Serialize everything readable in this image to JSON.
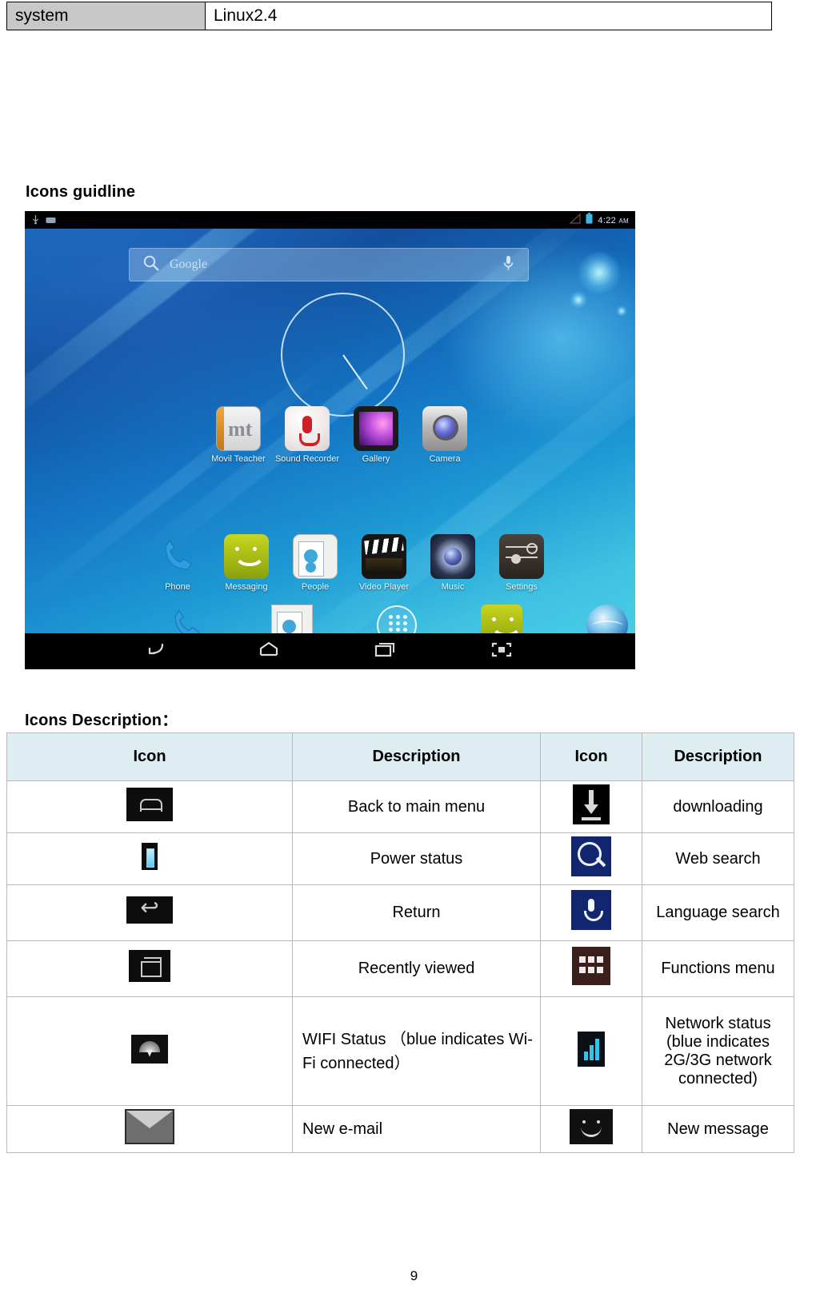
{
  "spec_table": {
    "rows": [
      {
        "key": "system",
        "value": "Linux2.4"
      }
    ]
  },
  "headings": {
    "guidline": "Icons guidline",
    "description": "Icons Description："
  },
  "tablet_screenshot": {
    "status_bar": {
      "time": "4:22",
      "ampm": "AM",
      "left_icons": [
        "usb-debug-icon",
        "sd-card-icon"
      ],
      "right_icons": [
        "signal-icon",
        "battery-icon"
      ]
    },
    "search_widget": {
      "placeholder": "Google",
      "search_icon": "search-icon",
      "mic_icon": "microphone-icon"
    },
    "clock_widget": "analog-clock-widget",
    "app_rows": [
      {
        "apps": [
          {
            "label": "Movil Teacher",
            "icon": "movil-teacher-icon"
          },
          {
            "label": "Sound Recorder",
            "icon": "sound-recorder-icon"
          },
          {
            "label": "Gallery",
            "icon": "gallery-icon"
          },
          {
            "label": "Camera",
            "icon": "camera-icon"
          }
        ]
      },
      {
        "apps": [
          {
            "label": "Phone",
            "icon": "phone-icon"
          },
          {
            "label": "Messaging",
            "icon": "messaging-icon"
          },
          {
            "label": "People",
            "icon": "people-icon"
          },
          {
            "label": "Video Player",
            "icon": "video-player-icon"
          },
          {
            "label": "Music",
            "icon": "music-icon"
          },
          {
            "label": "Settings",
            "icon": "settings-icon"
          }
        ]
      }
    ],
    "dock": [
      {
        "icon": "phone-icon"
      },
      {
        "icon": "people-icon"
      },
      {
        "icon": "app-drawer-icon"
      },
      {
        "icon": "messaging-icon"
      },
      {
        "icon": "browser-icon"
      }
    ],
    "nav_bar": [
      {
        "icon": "back-icon"
      },
      {
        "icon": "home-icon"
      },
      {
        "icon": "recent-apps-icon"
      },
      {
        "icon": "screenshot-icon"
      }
    ]
  },
  "icons_table": {
    "headers": [
      "Icon",
      "Description",
      "Icon",
      "Description"
    ],
    "rows": [
      {
        "icon_left": "home-icon",
        "desc_left": "Back to main menu",
        "icon_right": "download-icon",
        "desc_right": "downloading"
      },
      {
        "icon_left": "battery-icon",
        "desc_left": "Power status",
        "icon_right": "web-search-icon",
        "desc_right": "Web search"
      },
      {
        "icon_left": "return-icon",
        "desc_left": "Return",
        "icon_right": "voice-search-icon",
        "desc_right": "Language search"
      },
      {
        "icon_left": "recent-apps-icon",
        "desc_left": "Recently viewed",
        "icon_right": "functions-menu-icon",
        "desc_right": "Functions menu"
      },
      {
        "icon_left": "wifi-icon",
        "desc_left": "WIFI Status （blue indicates Wi-Fi connected）",
        "icon_right": "network-signal-icon",
        "desc_right": "Network status (blue indicates 2G/3G network connected)"
      },
      {
        "icon_left": "email-icon",
        "desc_left": "New e-mail",
        "icon_right": "new-message-icon",
        "desc_right": "New message"
      }
    ]
  },
  "page_number": "9",
  "colors": {
    "spec_key_bg": "#c8c8c8",
    "table_header_bg": "#ddedf2",
    "table_border": "#b8b8b8",
    "accent_blue": "#11266e"
  }
}
